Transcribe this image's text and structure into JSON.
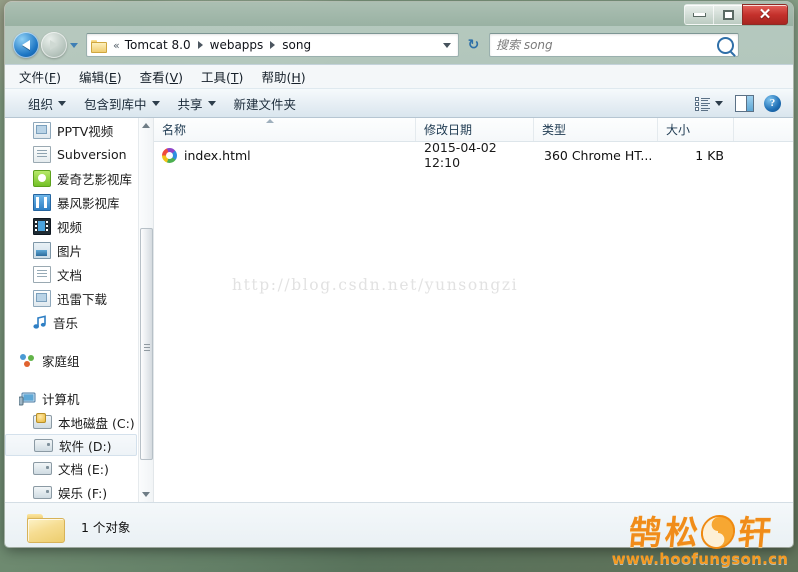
{
  "window": {
    "controls": {
      "minimize": "Minimize",
      "maximize": "Restore",
      "close": "Close",
      "close_glyph": "✕"
    },
    "colors": {
      "close_red": "#c4302b",
      "accent_blue": "#1d76c4",
      "logo_orange": "#f08c1a",
      "selection_blue": "#d4e1ec"
    }
  },
  "nav": {
    "back_label": "后退",
    "forward_label": "前进",
    "recent_label": "最近浏览的位置",
    "refresh_label": "刷新",
    "refresh_glyph": "↻",
    "breadcrumb_overflow": "«",
    "breadcrumb": [
      "Tomcat 8.0",
      "webapps",
      "song"
    ],
    "separator": "▸"
  },
  "search": {
    "placeholder": "搜索 song",
    "value": "",
    "icon": "search-icon"
  },
  "menubar": {
    "items": [
      {
        "pre": "文件(",
        "key": "F",
        "post": ")"
      },
      {
        "pre": "编辑(",
        "key": "E",
        "post": ")"
      },
      {
        "pre": "查看(",
        "key": "V",
        "post": ")"
      },
      {
        "pre": "工具(",
        "key": "T",
        "post": ")"
      },
      {
        "pre": "帮助(",
        "key": "H",
        "post": ")"
      }
    ]
  },
  "toolbar": {
    "organize": "组织",
    "include_in_library": "包含到库中",
    "share": "共享",
    "new_folder": "新建文件夹",
    "view_label": "更改您的视图",
    "preview_label": "显示预览窗格",
    "help_label": "获取帮助",
    "help_glyph": "?"
  },
  "sidebar": {
    "items": [
      {
        "label": "PPTV视频",
        "icon": "library-icon",
        "indent": "child"
      },
      {
        "label": "Subversion",
        "icon": "library-icon",
        "indent": "child"
      },
      {
        "label": "爱奇艺影视库",
        "icon": "iqiyi-icon",
        "indent": "child"
      },
      {
        "label": "暴风影视库",
        "icon": "film-icon",
        "indent": "child"
      },
      {
        "label": "视频",
        "icon": "video-icon",
        "indent": "child"
      },
      {
        "label": "图片",
        "icon": "pictures-icon",
        "indent": "child"
      },
      {
        "label": "文档",
        "icon": "documents-icon",
        "indent": "child"
      },
      {
        "label": "迅雷下载",
        "icon": "library-icon",
        "indent": "child"
      },
      {
        "label": "音乐",
        "icon": "music-icon",
        "indent": "child"
      },
      {
        "label": "家庭组",
        "icon": "homegroup-icon",
        "indent": "root",
        "spaced": true
      },
      {
        "label": "计算机",
        "icon": "computer-icon",
        "indent": "root",
        "spaced": true
      },
      {
        "label": "本地磁盘 (C:)",
        "icon": "system-drive-icon",
        "indent": "child"
      },
      {
        "label": "软件 (D:)",
        "icon": "drive-icon",
        "indent": "child",
        "selected": true
      },
      {
        "label": "文档 (E:)",
        "icon": "drive-icon",
        "indent": "child"
      },
      {
        "label": "娱乐 (F:)",
        "icon": "drive-icon",
        "indent": "child"
      }
    ]
  },
  "filelist": {
    "columns": [
      {
        "label": "名称",
        "sorted": true
      },
      {
        "label": "修改日期"
      },
      {
        "label": "类型"
      },
      {
        "label": "大小"
      }
    ],
    "rows": [
      {
        "name": "index.html",
        "date": "2015-04-02 12:10",
        "type": "360 Chrome HT...",
        "size": "1 KB",
        "icon": "chrome-360-icon"
      }
    ],
    "watermark": "http://blog.csdn.net/yunsongzi"
  },
  "statusbar": {
    "text": "1 个对象",
    "icon": "folder-icon"
  },
  "logo": {
    "char1": "鹄",
    "char2": "松",
    "char3": "轩",
    "symbol": "yin-yang-icon",
    "url": "www.hoofungson.cn"
  }
}
